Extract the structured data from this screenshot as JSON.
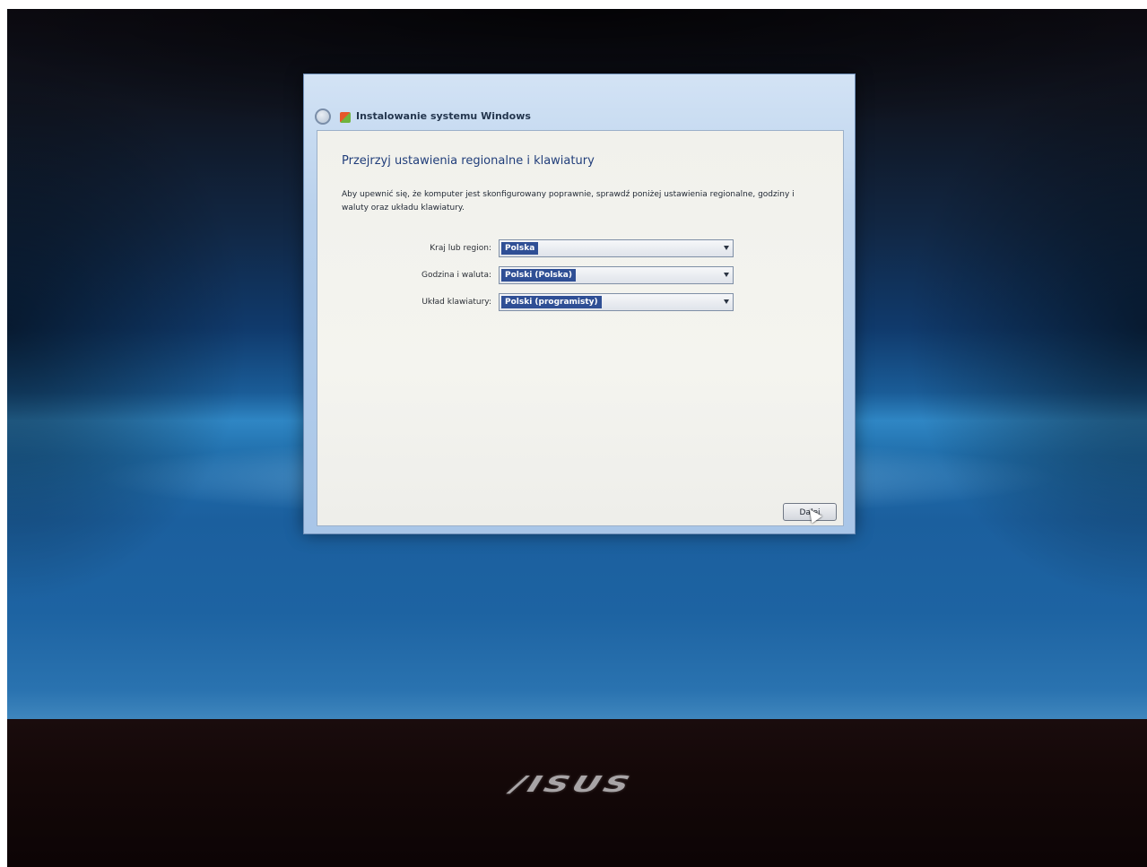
{
  "brand": {
    "logo_text": "/ISUS"
  },
  "window": {
    "title": "Instalowanie systemu Windows",
    "heading": "Przejrzyj ustawienia regionalne i klawiatury",
    "description": "Aby upewnić się, że komputer jest skonfigurowany poprawnie, sprawdź poniżej ustawienia regionalne, godziny i waluty oraz układu klawiatury."
  },
  "form": {
    "country": {
      "label": "Kraj lub region:",
      "value": "Polska"
    },
    "time_currency": {
      "label": "Godzina i waluta:",
      "value": "Polski (Polska)"
    },
    "keyboard": {
      "label": "Układ klawiatury:",
      "value": "Polski (programisty)"
    }
  },
  "buttons": {
    "next_label": "Dalej"
  }
}
